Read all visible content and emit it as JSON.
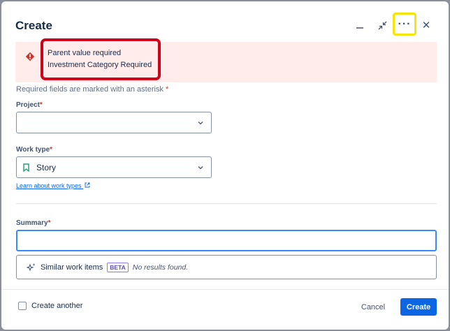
{
  "dialog": {
    "title": "Create",
    "header_icons": [
      "minimize-icon",
      "collapse-icon",
      "more-icon",
      "close-icon"
    ],
    "more_label": "···",
    "close_label": "✕"
  },
  "alert": {
    "icon": "error-icon",
    "messages": [
      "Parent value required",
      "Investment Category Required"
    ]
  },
  "required_note": {
    "text": "Required fields are marked with an asterisk",
    "asterisk": "*"
  },
  "project": {
    "label": "Project",
    "asterisk": "*",
    "value": ""
  },
  "work_type": {
    "label": "Work type",
    "asterisk": "*",
    "value": "Story",
    "icon": "story-icon",
    "learn_link": "Learn about work types"
  },
  "summary": {
    "label": "Summary",
    "asterisk": "*",
    "value": ""
  },
  "similar": {
    "label": "Similar work items",
    "badge": "BETA",
    "status": "No results found."
  },
  "footer": {
    "create_another": "Create another",
    "cancel": "Cancel",
    "create": "Create"
  },
  "colors": {
    "primary": "#0c66e4",
    "error_bg": "#ffeceb",
    "error_icon": "#c9372c",
    "annotation_red": "#d0021b",
    "annotation_yellow": "#f5e50a"
  }
}
